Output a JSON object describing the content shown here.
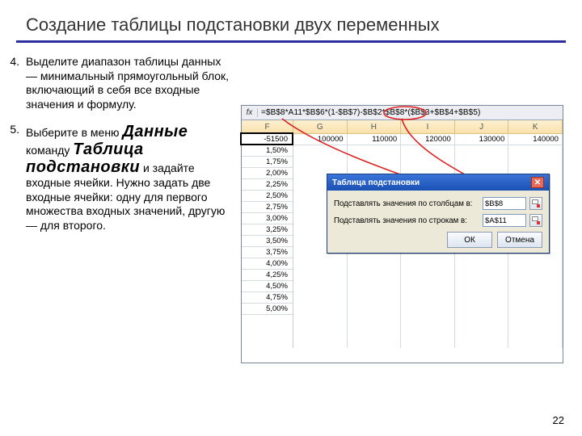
{
  "title": "Создание таблицы подстановки двух переменных",
  "list": {
    "n4": "4.",
    "t4": "Выделите диапазон таблицы данных — минимальный прямоугольный блок, включающий в себя все входные значения и формулу.",
    "n5": "5.",
    "t5a": " Выберите в меню ",
    "t5m1": "Данные",
    "t5b": " команду ",
    "t5m2": "Таблица подстановки",
    "t5c": " и задайте входные ячейки. Нужно задать две входные ячейки: одну для первого множества входных значений, другую — для второго."
  },
  "page": "22",
  "excel": {
    "fx": "fx",
    "formula": "=$B$8*A11*$B$6*(1-$B$7)-$B$2*$B$8*($B$3+$B$4+$B$5)",
    "heads": {
      "F": "F",
      "G": "G",
      "H": "H",
      "I": "I",
      "J": "J",
      "K": "K"
    },
    "colF": [
      "-51500",
      "1,50%",
      "1,75%",
      "2,00%",
      "2,25%",
      "2,50%",
      "2,75%",
      "3,00%",
      "3,25%",
      "3,50%",
      "3,75%",
      "4,00%",
      "4,25%",
      "4,50%",
      "4,75%",
      "5,00%"
    ],
    "rowTop": [
      "100000",
      "110000",
      "120000",
      "130000",
      "140000"
    ]
  },
  "dlg": {
    "title": "Таблица подстановки",
    "l1": "Подставлять значения по столбцам в:",
    "v1": "$B$8",
    "l2": "Подставлять значения по строкам в:",
    "v2": "$A$11",
    "ok": "ОК",
    "cancel": "Отмена"
  }
}
